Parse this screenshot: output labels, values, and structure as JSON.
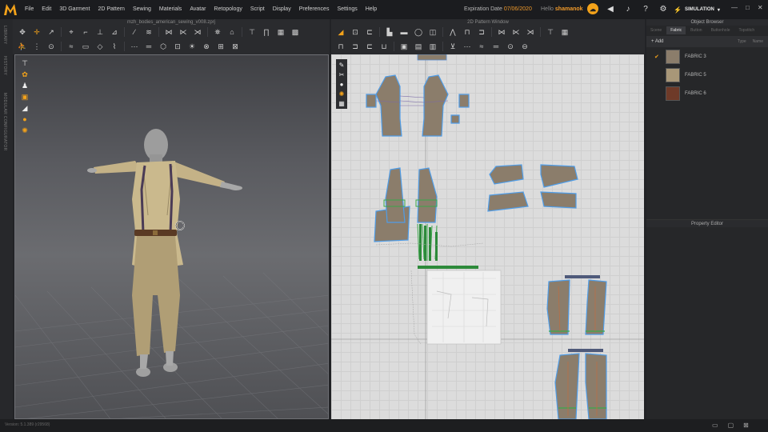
{
  "app": {
    "logo_letter": "M",
    "accent": "#f3a21a",
    "menu": [
      "File",
      "Edit",
      "3D Garment",
      "2D Pattern",
      "Sewing",
      "Materials",
      "Avatar",
      "Retopology",
      "Script",
      "Display",
      "Preferences",
      "Settings",
      "Help"
    ],
    "expiry_label": "Expiration Date",
    "expiry_date": "07/06/2020",
    "hello_label": "Hello",
    "username": "shamanok",
    "mode": "SIMULATION"
  },
  "sidebar": {
    "labels": [
      "LIBRARY",
      "HISTORY",
      "MODULAR CONFIGURATOR"
    ]
  },
  "view3d": {
    "title": "mzh_bodies_american_sewing_v008.zprj"
  },
  "view2d": {
    "title": "2D Pattern Window"
  },
  "object_browser": {
    "title": "Object Browser",
    "tabs": [
      "Scene",
      "Fabric",
      "Button",
      "Buttonhole",
      "Topstitch"
    ],
    "active_tab": "Fabric",
    "add_label": "Add",
    "sort_labels": [
      "Type",
      "Name"
    ],
    "fabrics": [
      {
        "name": "FABRIC 3",
        "color": "#8b7d6b",
        "selected": true
      },
      {
        "name": "FABRIC 5",
        "color": "#a89778",
        "selected": false
      },
      {
        "name": "FABRIC 6",
        "color": "#6e3a28",
        "selected": false
      }
    ]
  },
  "property_editor": {
    "title": "Property Editor"
  },
  "status": {
    "version": "Version: 5.1.389 (r29568)"
  }
}
